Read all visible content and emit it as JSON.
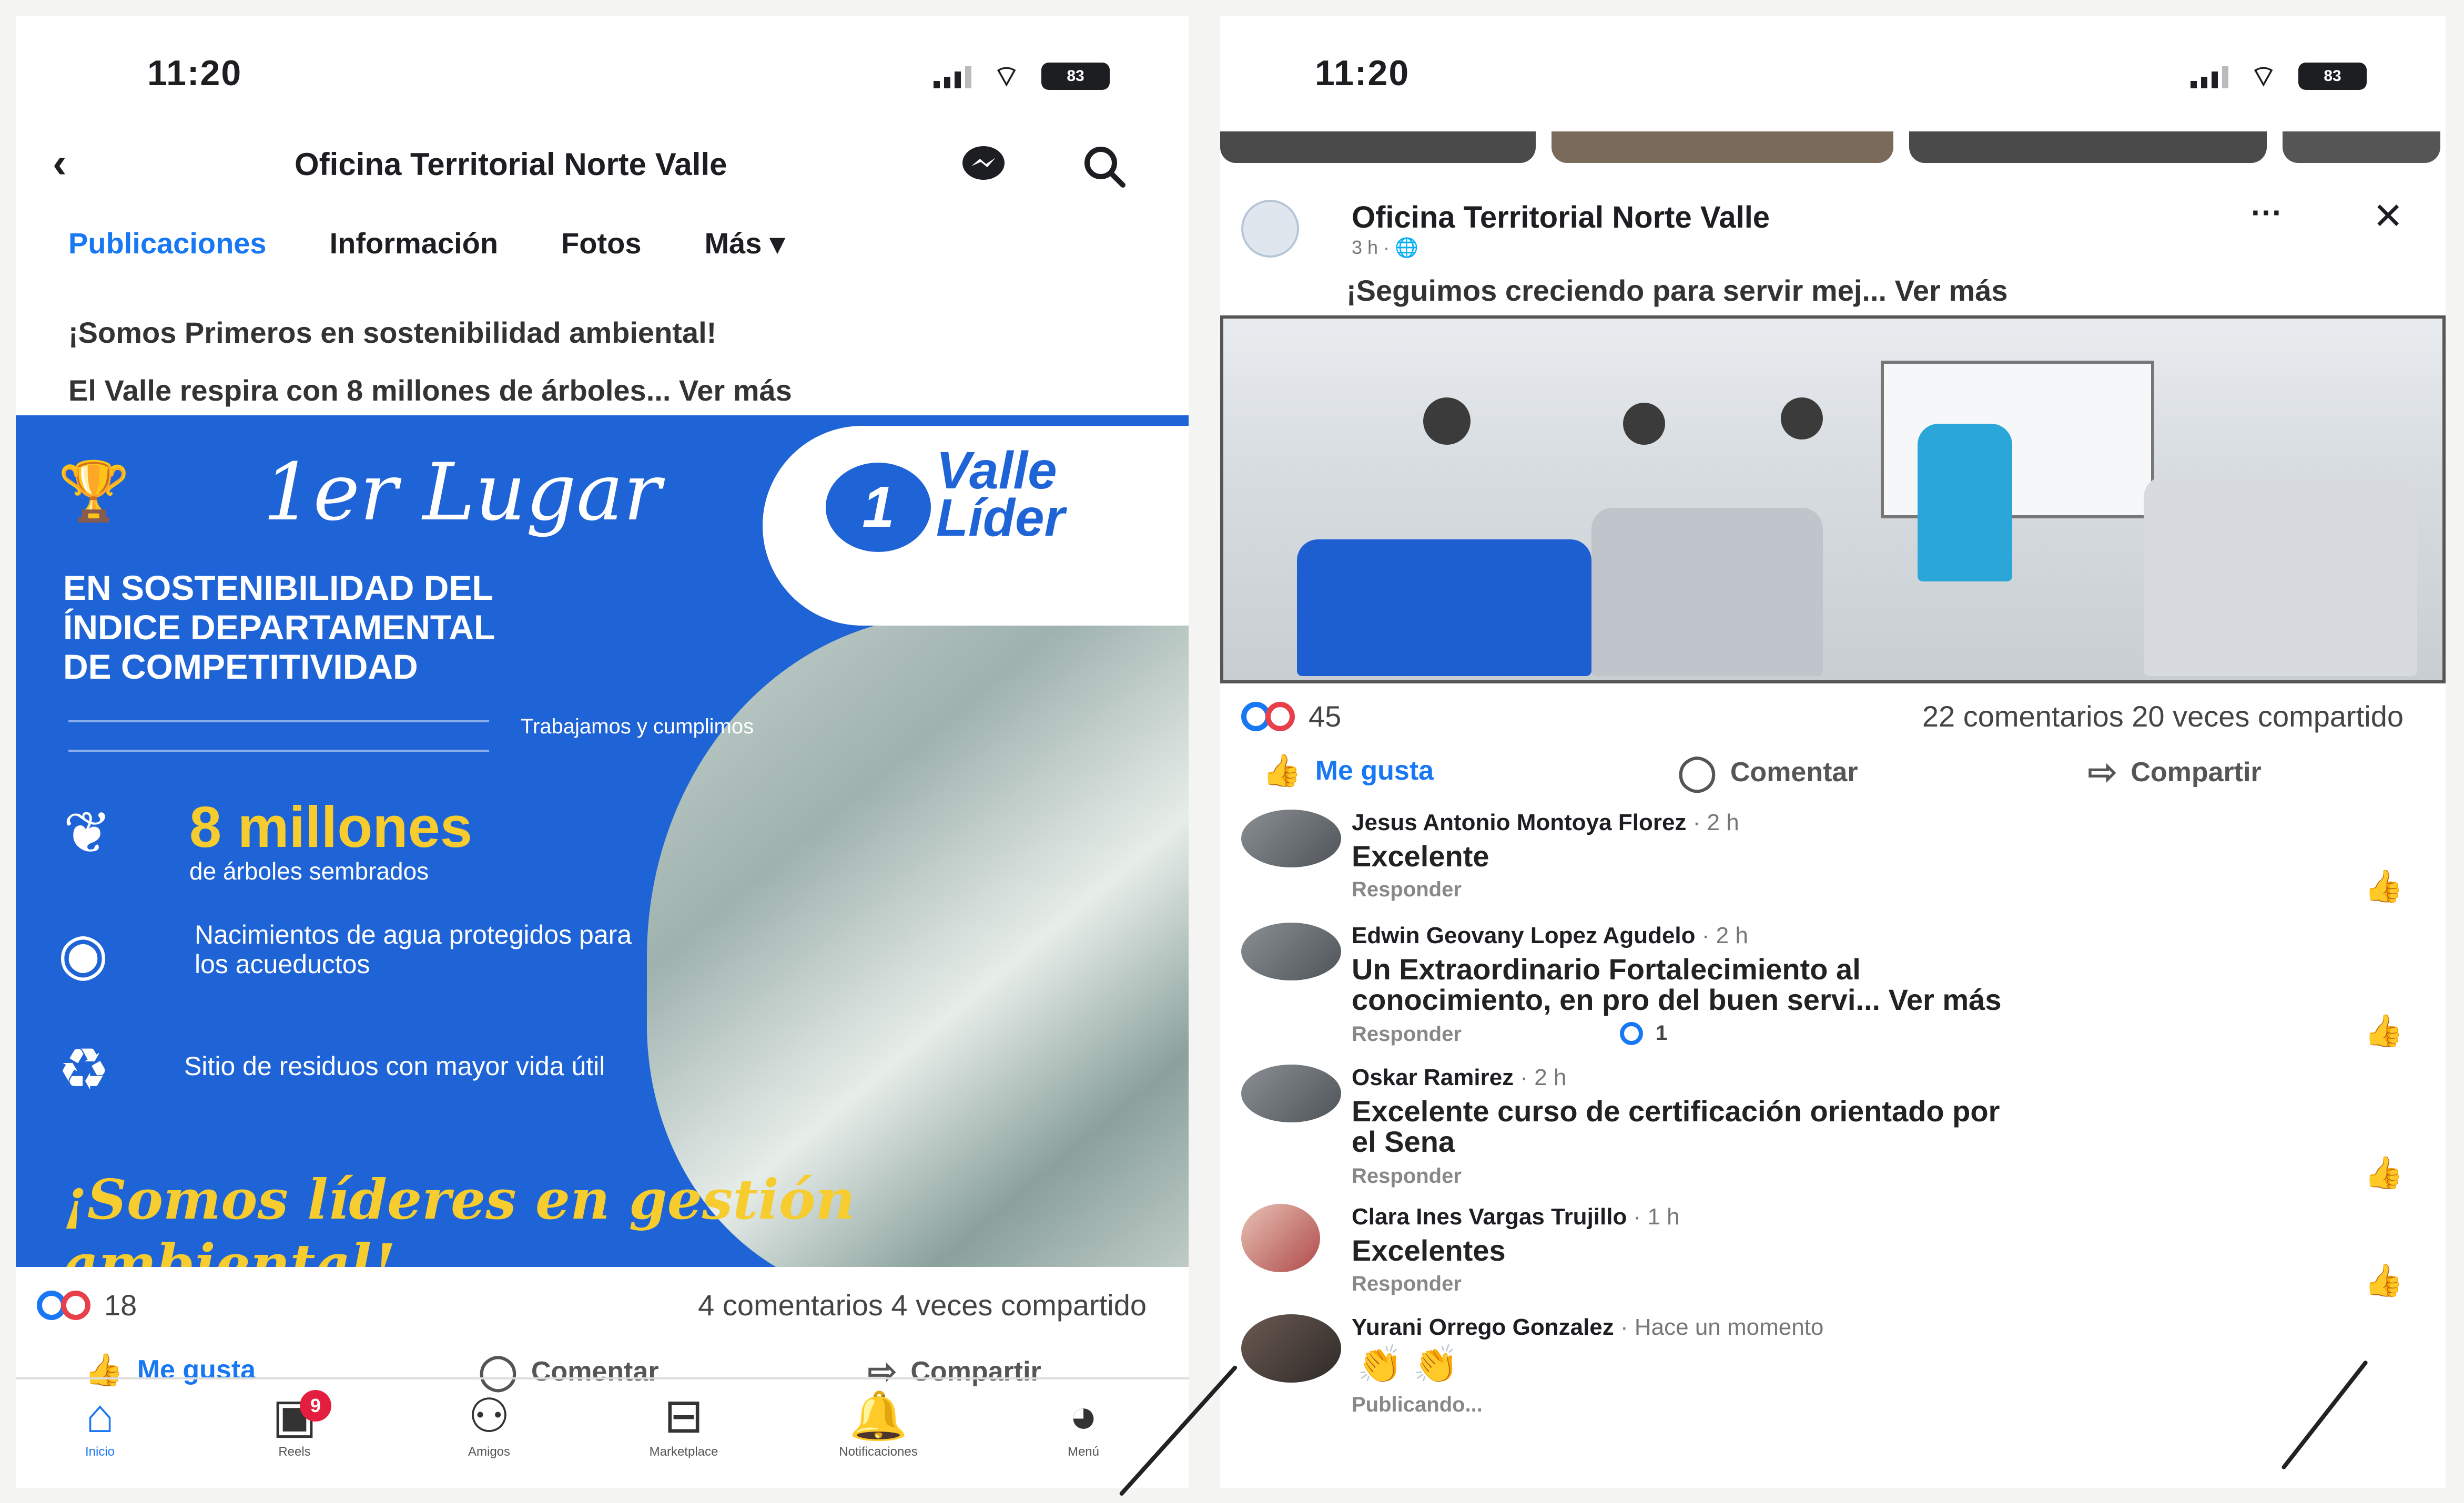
{
  "status": {
    "time": "11:20",
    "battery": "83"
  },
  "left": {
    "header": {
      "title": "Oficina Territorial Norte Valle"
    },
    "tabs": [
      "Publicaciones",
      "Información",
      "Fotos",
      "Más"
    ],
    "post": {
      "line1": "¡Somos Primeros en sostenibilidad ambiental!",
      "line2": "El Valle respira con 8 millones de árboles... Ver más",
      "flyer": {
        "badge_num": "1",
        "badge_text_1": "Valle",
        "badge_text_2": "Líder",
        "rank": "1er Lugar",
        "headline_1": "EN SOSTENIBILIDAD DEL",
        "headline_2": "ÍNDICE DEPARTAMENTAL",
        "headline_3": "DE COMPETITIVIDAD",
        "slogan_small": "Trabajamos y cumplimos",
        "stat_big": "8 millones",
        "stat_sub": "de árboles sembrados",
        "item2": "Nacimientos de agua protegidos para los acueductos",
        "item3": "Sitio de residuos con mayor vida útil",
        "tagline": "¡Somos líderes en gestión ambiental!"
      },
      "reactions_count": "18",
      "comments": "4 comentarios",
      "shares": "4 veces compartido"
    },
    "actions": {
      "like": "Me gusta",
      "comment": "Comentar",
      "share": "Compartir"
    },
    "nav": [
      {
        "label": "Inicio",
        "icon": "home-icon"
      },
      {
        "label": "Reels",
        "icon": "reels-icon",
        "badge": "9"
      },
      {
        "label": "Amigos",
        "icon": "friends-icon"
      },
      {
        "label": "Marketplace",
        "icon": "marketplace-icon"
      },
      {
        "label": "Notificaciones",
        "icon": "bell-icon"
      },
      {
        "label": "Menú",
        "icon": "menu-avatar-icon"
      }
    ]
  },
  "right": {
    "post": {
      "author": "Oficina Territorial Norte Valle",
      "meta": "3 h · ",
      "text": "¡Seguimos creciendo para servir mej... Ver más",
      "reactions_count": "45",
      "comments": "22 comentarios",
      "shares": "20 veces compartido"
    },
    "actions": {
      "like": "Me gusta",
      "comment": "Comentar",
      "share": "Compartir"
    },
    "comments": [
      {
        "author": "Jesus Antonio Montoya Florez",
        "time": " · 2 h",
        "text": "Excelente",
        "reply": "Responder"
      },
      {
        "author": "Edwin Geovany Lopez Agudelo",
        "time": " · 2 h",
        "text_1": "Un Extraordinario Fortalecimiento al",
        "text_2": "conocimiento, en pro del buen servi... Ver más",
        "reply": "Responder",
        "react_count": "1"
      },
      {
        "author": "Oskar Ramirez",
        "time": " · 2 h",
        "text_1": "Excelente curso de certificación  orientado por",
        "text_2": "el Sena",
        "reply": "Responder"
      },
      {
        "author": "Clara Ines Vargas Trujillo",
        "time": " · 1 h",
        "text": "Excelentes",
        "reply": "Responder"
      },
      {
        "author": "Yurani Orrego Gonzalez",
        "time": " · Hace un momento",
        "status": "Publicando..."
      }
    ]
  }
}
